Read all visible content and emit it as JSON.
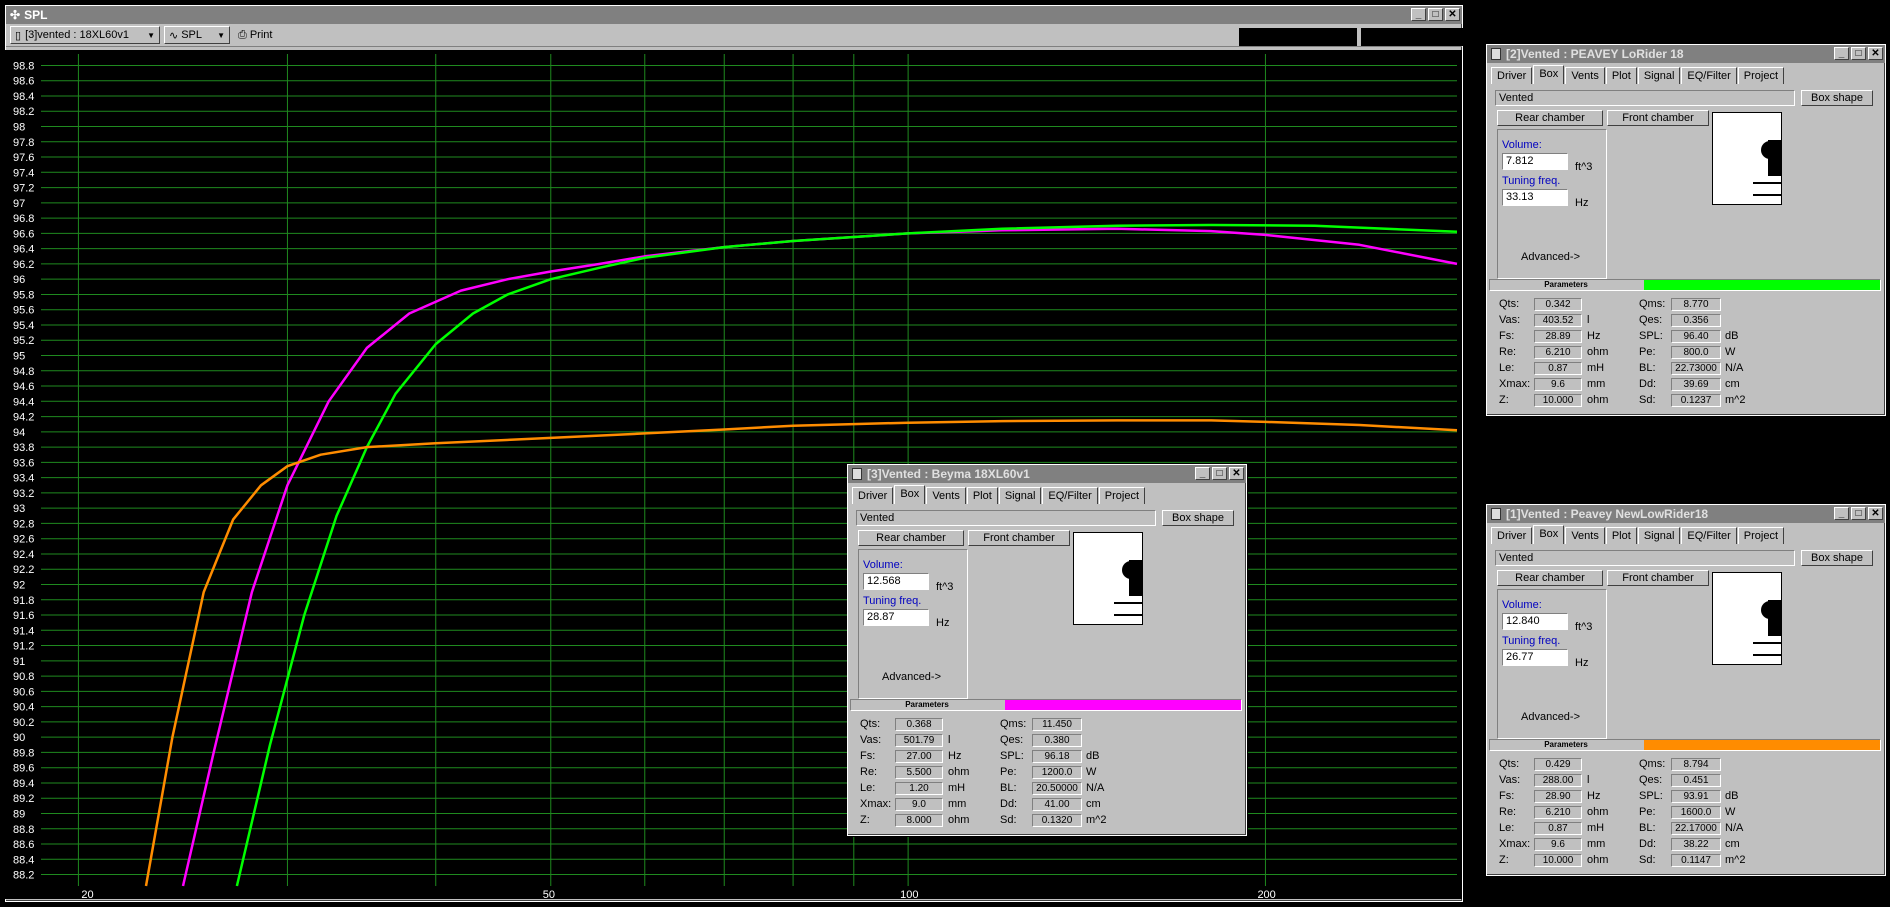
{
  "spl_window": {
    "title": "SPL",
    "project_dropdown": "[3]vented : 18XL60v1",
    "mode_dropdown": "SPL",
    "print_label": "Print"
  },
  "chart_data": {
    "type": "line",
    "xscale": "log",
    "xlim": [
      18.6,
      290
    ],
    "ylim": [
      88.05,
      98.95
    ],
    "y_ticks": [
      "98.8",
      "98.6",
      "98.4",
      "98.2",
      "98",
      "97.8",
      "97.6",
      "97.4",
      "97.2",
      "97",
      "96.8",
      "96.6",
      "96.4",
      "96.2",
      "96",
      "95.8",
      "95.6",
      "95.4",
      "95.2",
      "95",
      "94.8",
      "94.6",
      "94.4",
      "94.2",
      "94",
      "93.8",
      "93.6",
      "93.4",
      "93.2",
      "93",
      "92.8",
      "92.6",
      "92.4",
      "92.2",
      "92",
      "91.8",
      "91.6",
      "91.4",
      "91.2",
      "91",
      "90.8",
      "90.6",
      "90.4",
      "90.2",
      "90",
      "89.8",
      "89.6",
      "89.4",
      "89.2",
      "89",
      "88.8",
      "88.6",
      "88.4",
      "88.2"
    ],
    "x_ticks": [
      {
        "value": 20,
        "label": "20"
      },
      {
        "value": 50,
        "label": "50"
      },
      {
        "value": 100,
        "label": "100"
      },
      {
        "value": 200,
        "label": "200"
      }
    ],
    "grid": true,
    "series": [
      {
        "color": "#ff00ff",
        "x": [
          24.5,
          26,
          28,
          30,
          32.5,
          35,
          38,
          42,
          46,
          50,
          55,
          60,
          70,
          80,
          100,
          120,
          150,
          180,
          200,
          240,
          290
        ],
        "y": [
          88.05,
          89.8,
          91.9,
          93.3,
          94.4,
          95.1,
          95.55,
          95.85,
          96.0,
          96.1,
          96.2,
          96.3,
          96.42,
          96.5,
          96.6,
          96.64,
          96.66,
          96.63,
          96.58,
          96.45,
          96.2
        ]
      },
      {
        "color": "#00ff00",
        "x": [
          27.2,
          29,
          31,
          33,
          35,
          37,
          40,
          43,
          46,
          50,
          55,
          60,
          70,
          80,
          100,
          120,
          150,
          180,
          220,
          290
        ],
        "y": [
          88.05,
          89.9,
          91.6,
          92.9,
          93.8,
          94.5,
          95.15,
          95.55,
          95.8,
          96.0,
          96.15,
          96.28,
          96.42,
          96.5,
          96.6,
          96.66,
          96.7,
          96.71,
          96.7,
          96.62
        ]
      },
      {
        "color": "#ff8c00",
        "x": [
          22.8,
          24,
          25.5,
          27,
          28.5,
          30,
          32,
          35,
          40,
          50,
          60,
          70,
          80,
          100,
          120,
          150,
          180,
          200,
          240,
          290
        ],
        "y": [
          88.05,
          90.0,
          91.9,
          92.85,
          93.3,
          93.55,
          93.7,
          93.8,
          93.85,
          93.92,
          93.98,
          94.03,
          94.08,
          94.12,
          94.14,
          94.15,
          94.15,
          94.13,
          94.09,
          94.02
        ]
      }
    ]
  },
  "windows": [
    {
      "title": "[2]Vented : PEAVEY LoRider 18",
      "tabs": [
        "Driver",
        "Box",
        "Vents",
        "Plot",
        "Signal",
        "EQ/Filter",
        "Project"
      ],
      "box_type": "Vented",
      "box_shape_label": "Box shape",
      "rear_chamber_label": "Rear chamber",
      "front_chamber_label": "Front chamber",
      "volume_label": "Volume:",
      "volume": "7.812",
      "volume_unit": "ft^3",
      "tuning_label": "Tuning freq.",
      "tuning": "33.13",
      "tuning_unit": "Hz",
      "advanced_label": "Advanced->",
      "params_label": "Parameters",
      "param_color": "#00ff00",
      "left_params": [
        {
          "name": "Qts:",
          "value": "0.342",
          "unit": ""
        },
        {
          "name": "Vas:",
          "value": "403.52",
          "unit": "l"
        },
        {
          "name": "Fs:",
          "value": "28.89",
          "unit": "Hz"
        },
        {
          "name": "Re:",
          "value": "6.210",
          "unit": "ohm"
        },
        {
          "name": "Le:",
          "value": "0.87",
          "unit": "mH"
        },
        {
          "name": "Xmax:",
          "value": "9.6",
          "unit": "mm"
        },
        {
          "name": "Z:",
          "value": "10.000",
          "unit": "ohm"
        }
      ],
      "right_params": [
        {
          "name": "Qms:",
          "value": "8.770",
          "unit": ""
        },
        {
          "name": "Qes:",
          "value": "0.356",
          "unit": ""
        },
        {
          "name": "SPL:",
          "value": "96.40",
          "unit": "dB"
        },
        {
          "name": "Pe:",
          "value": "800.0",
          "unit": "W"
        },
        {
          "name": "BL:",
          "value": "22.73000",
          "unit": "N/A"
        },
        {
          "name": "Dd:",
          "value": "39.69",
          "unit": "cm"
        },
        {
          "name": "Sd:",
          "value": "0.1237",
          "unit": "m^2"
        }
      ]
    },
    {
      "title": "[3]Vented : Beyma 18XL60v1",
      "tabs": [
        "Driver",
        "Box",
        "Vents",
        "Plot",
        "Signal",
        "EQ/Filter",
        "Project"
      ],
      "box_type": "Vented",
      "box_shape_label": "Box shape",
      "rear_chamber_label": "Rear chamber",
      "front_chamber_label": "Front chamber",
      "volume_label": "Volume:",
      "volume": "12.568",
      "volume_unit": "ft^3",
      "tuning_label": "Tuning freq.",
      "tuning": "28.87",
      "tuning_unit": "Hz",
      "advanced_label": "Advanced->",
      "params_label": "Parameters",
      "param_color": "#ff00ff",
      "left_params": [
        {
          "name": "Qts:",
          "value": "0.368",
          "unit": ""
        },
        {
          "name": "Vas:",
          "value": "501.79",
          "unit": "l"
        },
        {
          "name": "Fs:",
          "value": "27.00",
          "unit": "Hz"
        },
        {
          "name": "Re:",
          "value": "5.500",
          "unit": "ohm"
        },
        {
          "name": "Le:",
          "value": "1.20",
          "unit": "mH"
        },
        {
          "name": "Xmax:",
          "value": "9.0",
          "unit": "mm"
        },
        {
          "name": "Z:",
          "value": "8.000",
          "unit": "ohm"
        }
      ],
      "right_params": [
        {
          "name": "Qms:",
          "value": "11.450",
          "unit": ""
        },
        {
          "name": "Qes:",
          "value": "0.380",
          "unit": ""
        },
        {
          "name": "SPL:",
          "value": "96.18",
          "unit": "dB"
        },
        {
          "name": "Pe:",
          "value": "1200.0",
          "unit": "W"
        },
        {
          "name": "BL:",
          "value": "20.50000",
          "unit": "N/A"
        },
        {
          "name": "Dd:",
          "value": "41.00",
          "unit": "cm"
        },
        {
          "name": "Sd:",
          "value": "0.1320",
          "unit": "m^2"
        }
      ]
    },
    {
      "title": "[1]Vented : Peavey NewLowRider18",
      "tabs": [
        "Driver",
        "Box",
        "Vents",
        "Plot",
        "Signal",
        "EQ/Filter",
        "Project"
      ],
      "box_type": "Vented",
      "box_shape_label": "Box shape",
      "rear_chamber_label": "Rear chamber",
      "front_chamber_label": "Front chamber",
      "volume_label": "Volume:",
      "volume": "12.840",
      "volume_unit": "ft^3",
      "tuning_label": "Tuning freq.",
      "tuning": "26.77",
      "tuning_unit": "Hz",
      "advanced_label": "Advanced->",
      "params_label": "Parameters",
      "param_color": "#ff8c00",
      "left_params": [
        {
          "name": "Qts:",
          "value": "0.429",
          "unit": ""
        },
        {
          "name": "Vas:",
          "value": "288.00",
          "unit": "l"
        },
        {
          "name": "Fs:",
          "value": "28.90",
          "unit": "Hz"
        },
        {
          "name": "Re:",
          "value": "6.210",
          "unit": "ohm"
        },
        {
          "name": "Le:",
          "value": "0.87",
          "unit": "mH"
        },
        {
          "name": "Xmax:",
          "value": "9.6",
          "unit": "mm"
        },
        {
          "name": "Z:",
          "value": "10.000",
          "unit": "ohm"
        }
      ],
      "right_params": [
        {
          "name": "Qms:",
          "value": "8.794",
          "unit": ""
        },
        {
          "name": "Qes:",
          "value": "0.451",
          "unit": ""
        },
        {
          "name": "SPL:",
          "value": "93.91",
          "unit": "dB"
        },
        {
          "name": "Pe:",
          "value": "1600.0",
          "unit": "W"
        },
        {
          "name": "BL:",
          "value": "22.17000",
          "unit": "N/A"
        },
        {
          "name": "Dd:",
          "value": "38.22",
          "unit": "cm"
        },
        {
          "name": "Sd:",
          "value": "0.1147",
          "unit": "m^2"
        }
      ]
    }
  ]
}
